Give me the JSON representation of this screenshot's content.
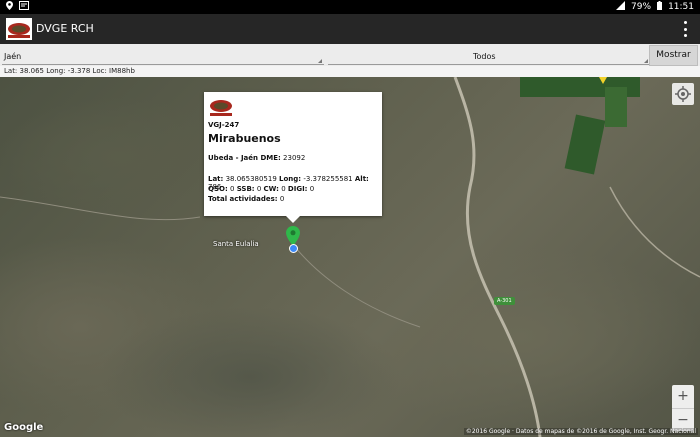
{
  "status_bar": {
    "battery": "79%",
    "time": "11:51"
  },
  "app_bar": {
    "title": "DVGE RCH"
  },
  "filters": {
    "province": "Jaén",
    "type": "Todos",
    "show_button": "Mostrar"
  },
  "coords_bar": {
    "text": "Lat: 38.065 Long: -3.378 Loc: IM88hb"
  },
  "map": {
    "town_label": "Santa Eulalia",
    "highway_label": "A-301",
    "google_logo": "Google",
    "attribution": "©2016 Google · Datos de mapas de ©2016 de Google, Inst. Geogr. Nacional",
    "zoom_in": "+",
    "zoom_out": "−"
  },
  "popup": {
    "code": "VGJ-247",
    "name": "Mirabuenos",
    "location_prefix": "Ubeda - Jaén DME:",
    "dme": "23092",
    "lat_label": "Lat:",
    "lat": "38.065380519",
    "long_label": "Long:",
    "long": "-3.378255581",
    "alt_label": "Alt:",
    "alt": "786",
    "qso_label": "QSO:",
    "qso": "0",
    "ssb_label": "SSB:",
    "ssb": "0",
    "cw_label": "CW:",
    "cw": "0",
    "digi_label": "DIGI:",
    "digi": "0",
    "total_label": "Total actividades:",
    "total": "0"
  },
  "colors": {
    "marker": "#2fb84a",
    "app_bar": "#262626",
    "location_dot": "#3d8af7"
  }
}
